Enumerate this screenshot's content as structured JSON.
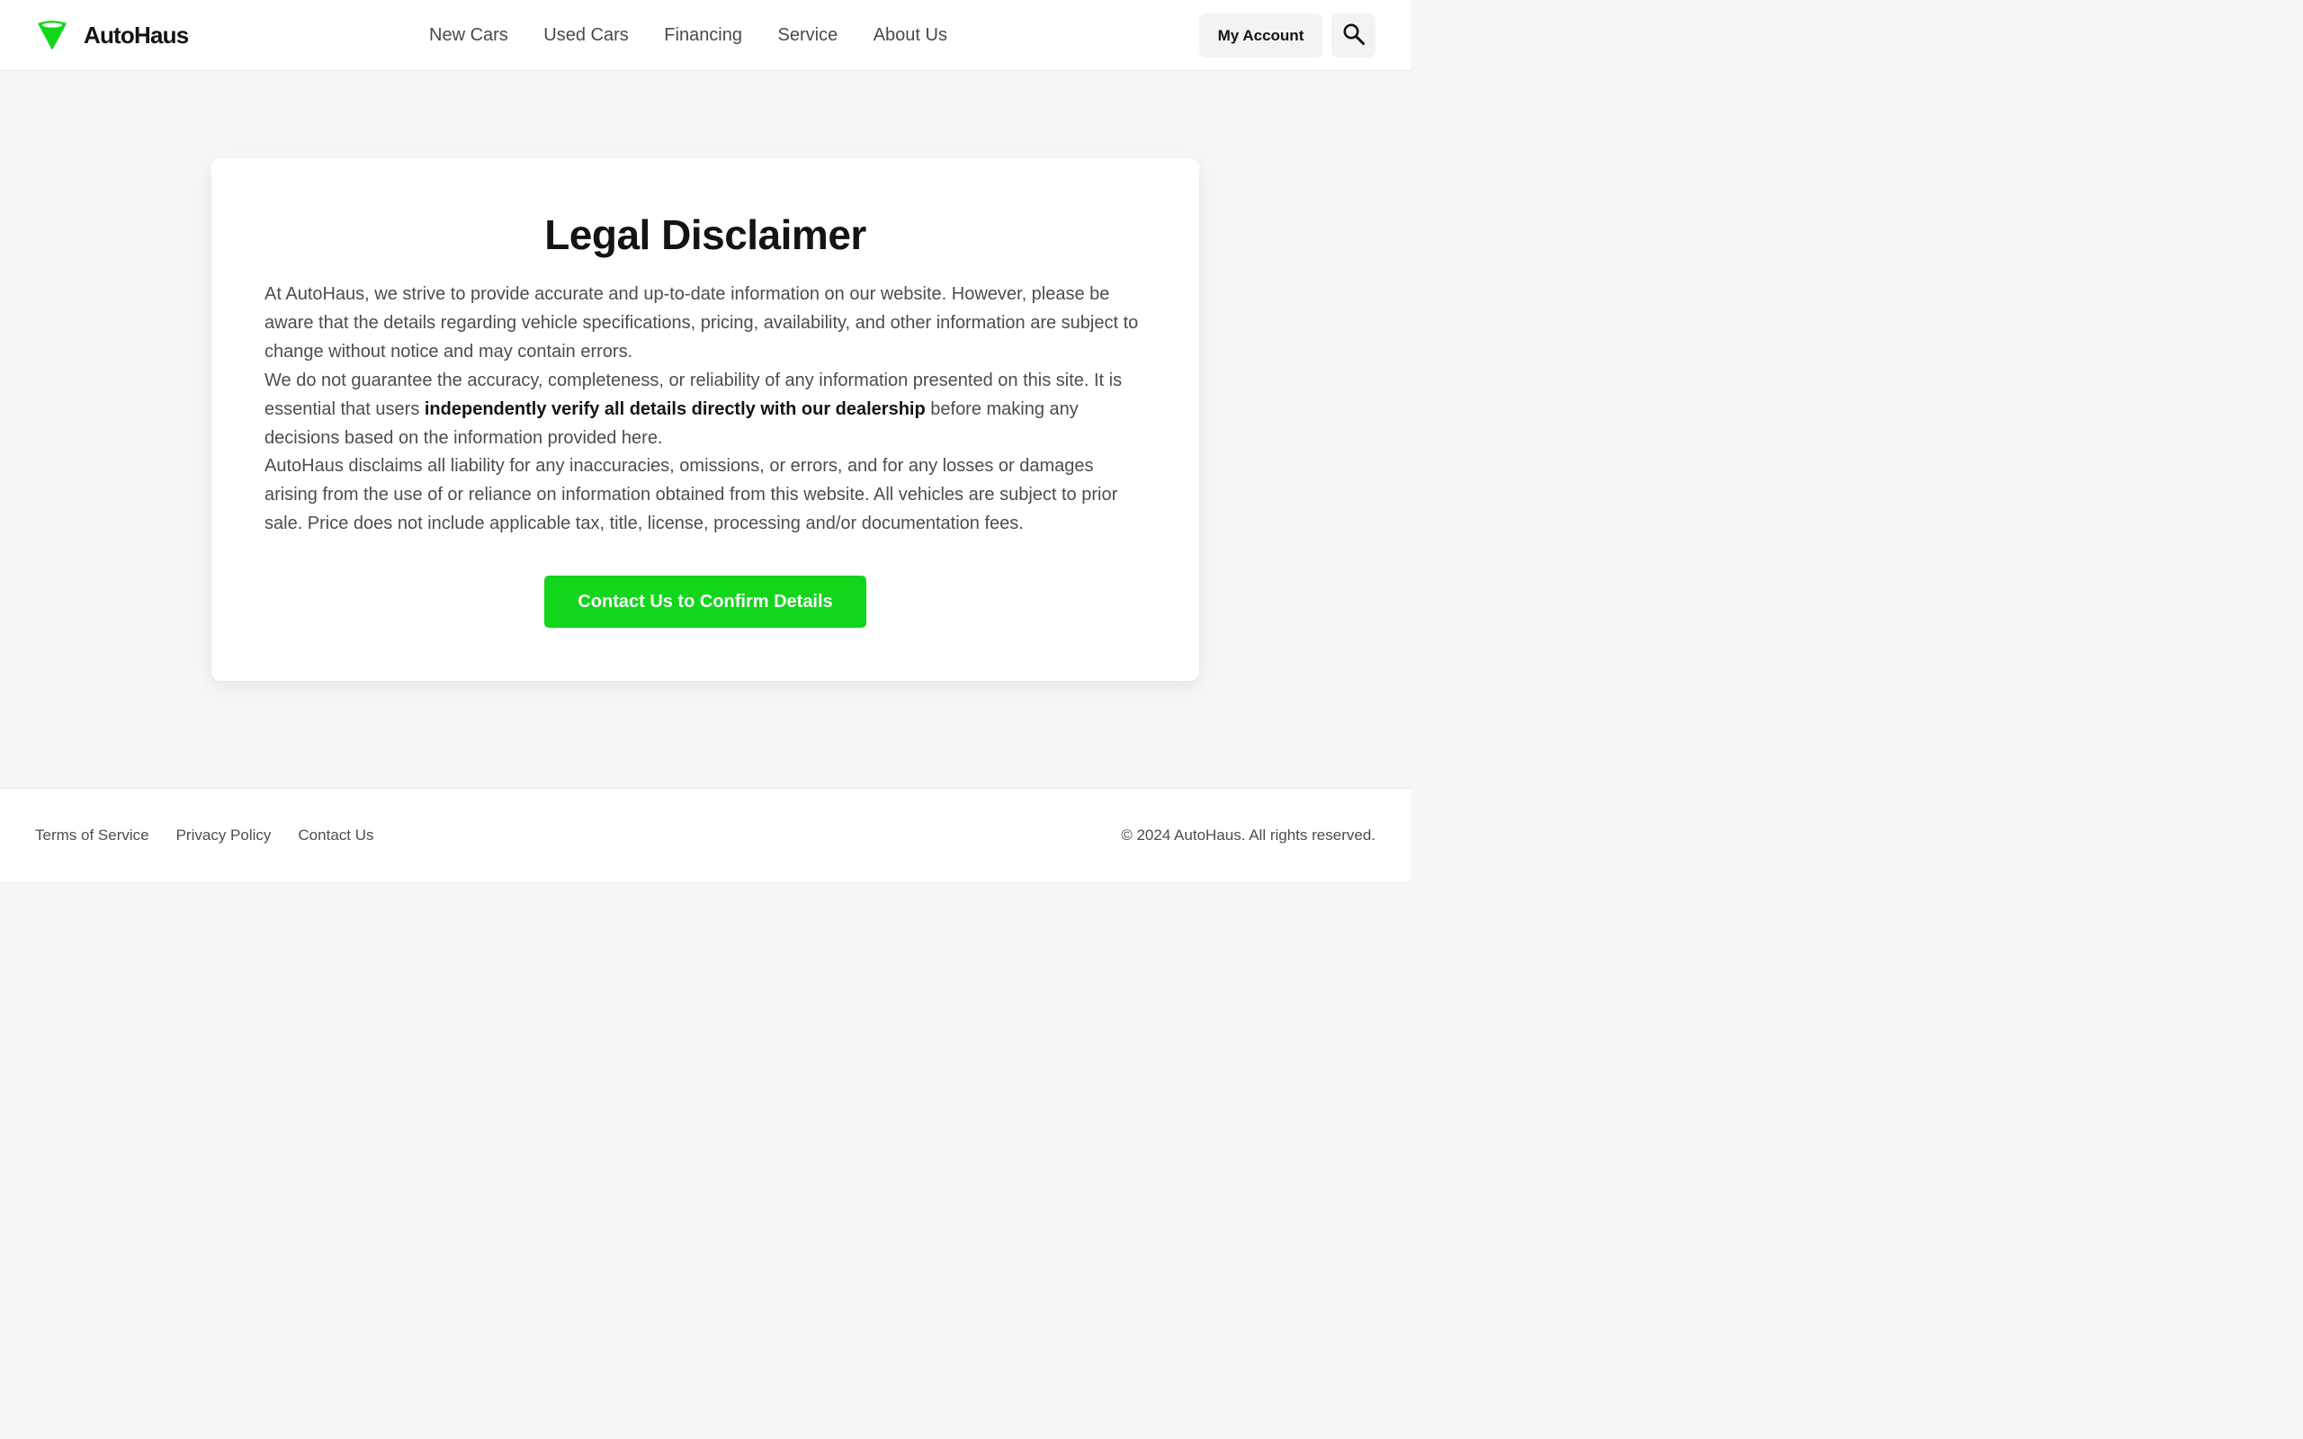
{
  "brand": {
    "name": "AutoHaus",
    "logo_icon": "green-cone-logo-icon",
    "accent_color": "#12d61b"
  },
  "nav": {
    "items": [
      {
        "label": "New Cars"
      },
      {
        "label": "Used Cars"
      },
      {
        "label": "Financing"
      },
      {
        "label": "Service"
      },
      {
        "label": "About Us"
      }
    ]
  },
  "header_actions": {
    "account_label": "My Account",
    "search_icon": "search-icon"
  },
  "disclaimer": {
    "title": "Legal Disclaimer",
    "paragraph_1": "At AutoHaus, we strive to provide accurate and up-to-date information on our website. However, please be aware that the details regarding vehicle specifications, pricing, availability, and other information are subject to change without notice and may contain errors.",
    "paragraph_2_before": "We do not guarantee the accuracy, completeness, or reliability of any information presented on this site. It is essential that users ",
    "paragraph_2_emphasis": "independently verify all details directly with our dealership",
    "paragraph_2_after": " before making any decisions based on the information provided here.",
    "paragraph_3": "AutoHaus disclaims all liability for any inaccuracies, omissions, or errors, and for any losses or damages arising from the use of or reliance on information obtained from this website. All vehicles are subject to prior sale. Price does not include applicable tax, title, license, processing and/or documentation fees.",
    "cta_label": "Contact Us to Confirm Details"
  },
  "footer": {
    "links": [
      {
        "label": "Terms of Service"
      },
      {
        "label": "Privacy Policy"
      },
      {
        "label": "Contact Us"
      }
    ],
    "copyright": "© 2024 AutoHaus. All rights reserved."
  }
}
